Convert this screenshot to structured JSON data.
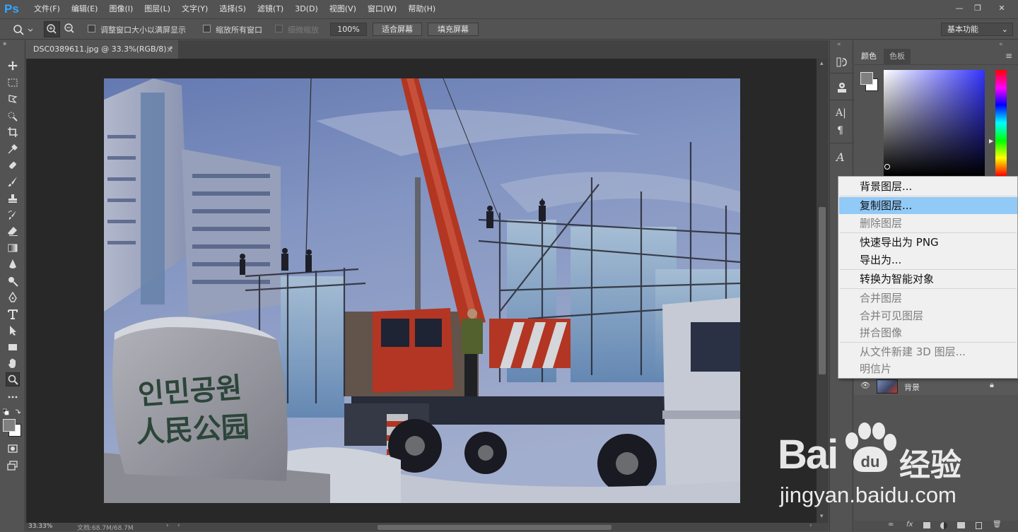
{
  "app": {
    "logo": "Ps"
  },
  "menubar": {
    "items": [
      "文件(F)",
      "编辑(E)",
      "图像(I)",
      "图层(L)",
      "文字(Y)",
      "选择(S)",
      "滤镜(T)",
      "3D(D)",
      "视图(V)",
      "窗口(W)",
      "帮助(H)"
    ]
  },
  "window_controls": {
    "minimize": "—",
    "restore": "❐",
    "close": "✕"
  },
  "options": {
    "resize_windows_label": "调整窗口大小以满屏显示",
    "zoom_all_label": "缩放所有窗口",
    "scrubby_zoom_label": "细微缩放",
    "zoom_value": "100%",
    "fit_screen_label": "适合屏幕",
    "fill_screen_label": "填充屏幕",
    "workspace": "基本功能"
  },
  "document": {
    "tab_title": "DSC0389611.jpg @ 33.3%(RGB/8) *",
    "tab_close": "×",
    "status_zoom": "33.33%",
    "status_doc": "文档:68.7M/68.7M"
  },
  "panels": {
    "color_tab": "颜色",
    "swatches_tab": "色板",
    "layer_name": "背景"
  },
  "context_menu": [
    {
      "label": "背景图层...",
      "state": "enabled"
    },
    {
      "label": "复制图层...",
      "state": "highlighted"
    },
    {
      "label": "删除图层",
      "state": "disabled"
    },
    {
      "label": "快速导出为 PNG",
      "state": "enabled"
    },
    {
      "label": "导出为...",
      "state": "enabled"
    },
    {
      "label": "转换为智能对象",
      "state": "enabled"
    },
    {
      "label": "合并图层",
      "state": "disabled"
    },
    {
      "label": "合并可见图层",
      "state": "disabled"
    },
    {
      "label": "拼合图像",
      "state": "disabled"
    },
    {
      "label": "从文件新建 3D 图层...",
      "state": "disabled"
    },
    {
      "label": "明信片",
      "state": "disabled"
    }
  ],
  "photo_text": {
    "stone_korean": "인민공원",
    "stone_chinese": "人民公园"
  },
  "watermark": {
    "brand": "Bai",
    "brand_cn": "经验",
    "url": "jingyan.baidu.com"
  },
  "colors": {
    "ui_bg": "#535353",
    "canvas_bg": "#282828",
    "highlight": "#91c9f7",
    "ps_blue": "#31a8ff",
    "crane_red": "#c8391f"
  }
}
